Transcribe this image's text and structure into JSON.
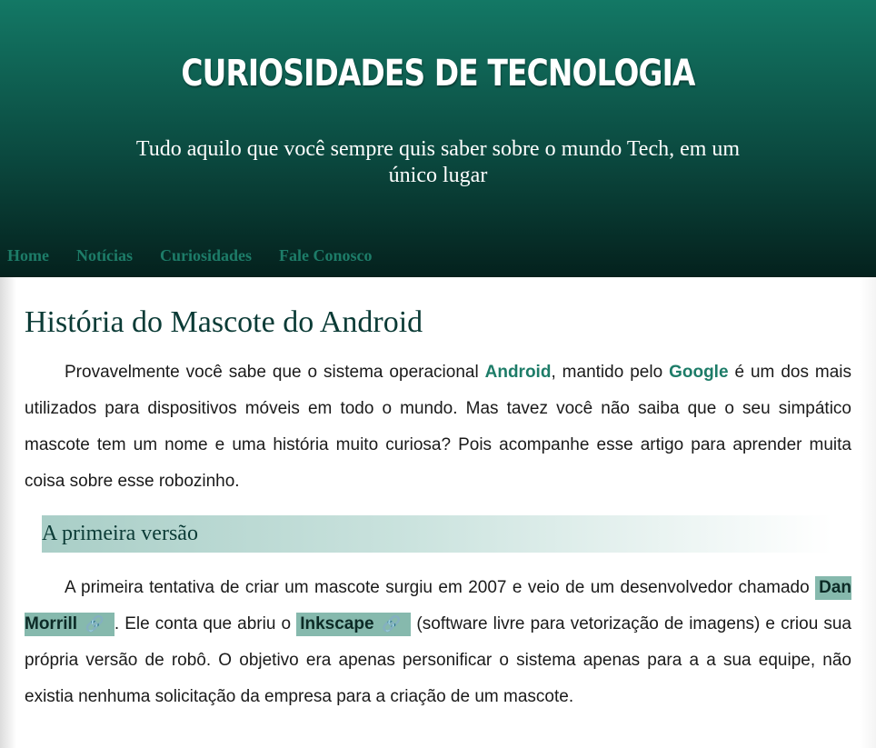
{
  "header": {
    "site_title": "CURIOSIDADES DE TECNOLOGIA",
    "subtitle": "Tudo aquilo que você sempre quis saber sobre o mundo Tech, em um único lugar"
  },
  "nav": {
    "items": [
      {
        "label": "Home"
      },
      {
        "label": "Notícias"
      },
      {
        "label": "Curiosidades"
      },
      {
        "label": "Fale Conosco"
      }
    ]
  },
  "article": {
    "title": "História do Mascote do Android",
    "p1": {
      "t1": "Provavelmente você sabe que o sistema operacional ",
      "k1": "Android",
      "t2": ", mantido pelo ",
      "k2": "Google",
      "t3": " é um dos mais utilizados para dispositivos móveis em todo o mundo. Mas tavez você não saiba que o seu simpático mascote tem um nome e uma história muito curiosa? Pois acompanhe esse artigo para aprender muita coisa sobre esse robozinho."
    },
    "section1": {
      "title": "A primeira versão",
      "p": {
        "t1": "A primeira tentativa de criar um mascote surgiu em 2007 e veio de um desenvolvedor chamado ",
        "link1": "Dan Morrill",
        "t2": ". Ele conta que abriu o ",
        "link2": "Inkscape",
        "t3": " (software livre para vetorização de imagens) e criou sua própria versão de robô. O objetivo era apenas personificar o sistema apenas para a a sua equipe, não existia nenhuma solicitação da empresa para a criação de um mascote."
      }
    }
  },
  "icons": {
    "external_link": "link-icon"
  },
  "colors": {
    "accent": "#1d7c68",
    "header_top": "#137865",
    "header_bottom": "#04211d",
    "chip_bg": "#86b9ad",
    "heading": "#0b3b36"
  }
}
